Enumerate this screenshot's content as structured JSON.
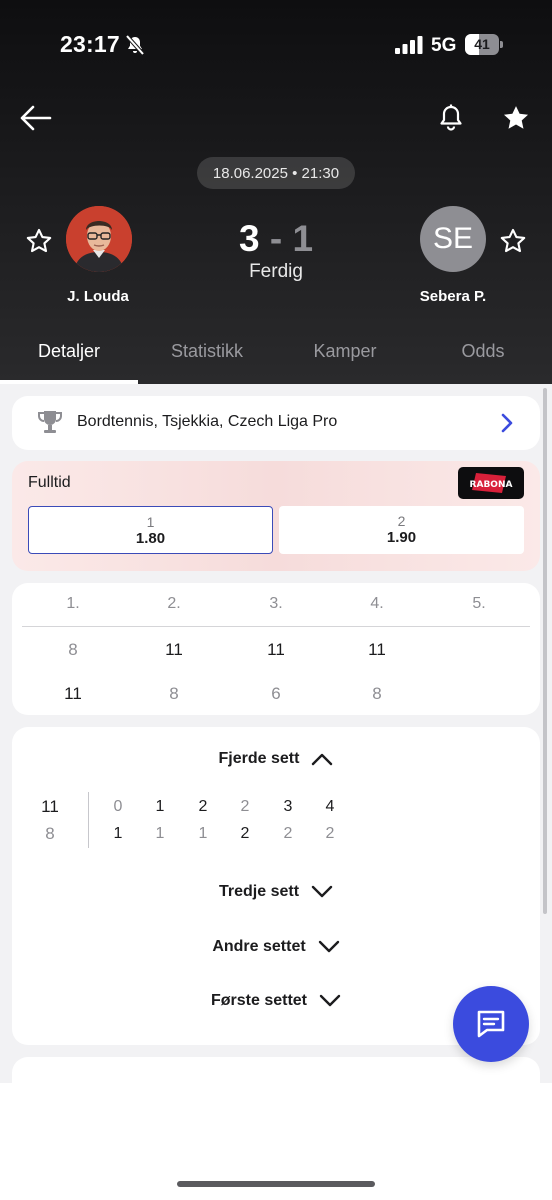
{
  "status_bar": {
    "time": "23:17",
    "network": "5G",
    "battery": "41",
    "battery_level": 0.41
  },
  "match": {
    "datetime": "18.06.2025 • 21:30",
    "home": {
      "name": "J. Louda"
    },
    "away": {
      "name": "Sebera P.",
      "initials": "SE"
    },
    "score_home": "3",
    "separator": "-",
    "score_away": "1",
    "status": "Ferdig"
  },
  "tabs": [
    {
      "label": "Detaljer",
      "active": true
    },
    {
      "label": "Statistikk",
      "active": false
    },
    {
      "label": "Kamper",
      "active": false
    },
    {
      "label": "Odds",
      "active": false
    }
  ],
  "league": {
    "name": "Bordtennis, Tsjekkia, Czech Liga Pro",
    "icon": "trophy-icon"
  },
  "odds": {
    "label": "Fulltid",
    "bookmaker": "RABONA",
    "options": [
      {
        "key": "1",
        "value": "1.80",
        "selected": true
      },
      {
        "key": "2",
        "value": "1.90",
        "selected": false
      }
    ]
  },
  "sets": {
    "headers": [
      "1.",
      "2.",
      "3.",
      "4.",
      "5."
    ],
    "home": [
      "8",
      "11",
      "11",
      "11",
      ""
    ],
    "away": [
      "11",
      "8",
      "6",
      "8",
      ""
    ]
  },
  "point_by_point": {
    "open_title": "Fjerde sett",
    "home_total": "11",
    "away_total": "8",
    "home_progress": [
      "0",
      "1",
      "2",
      "2",
      "3",
      "4"
    ],
    "away_progress": [
      "1",
      "1",
      "1",
      "2",
      "2",
      "2"
    ],
    "collapsed": [
      "Tredje sett",
      "Andre settet",
      "Første settet"
    ]
  },
  "colors": {
    "accent": "#3b4bde",
    "header_bg": "#1b1b1d",
    "page_bg": "#f2f2f4"
  }
}
